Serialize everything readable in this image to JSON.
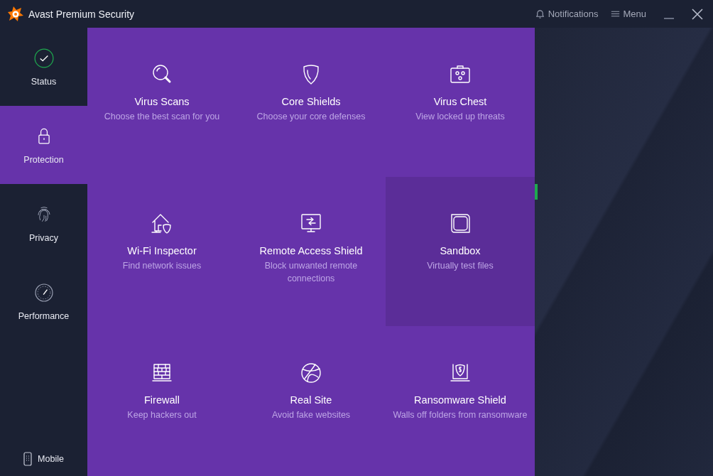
{
  "window": {
    "title": "Avast Premium Security",
    "notifications": "Notifications",
    "menu": "Menu"
  },
  "sidebar": {
    "items": [
      {
        "label": "Status",
        "selected": false
      },
      {
        "label": "Protection",
        "selected": true
      },
      {
        "label": "Privacy",
        "selected": false
      },
      {
        "label": "Performance",
        "selected": false
      }
    ],
    "mobile": "Mobile"
  },
  "tiles": [
    {
      "title": "Virus Scans",
      "subtitle": "Choose the best scan for you",
      "highlighted": false
    },
    {
      "title": "Core Shields",
      "subtitle": "Choose your core defenses",
      "highlighted": false
    },
    {
      "title": "Virus Chest",
      "subtitle": "View locked up threats",
      "highlighted": false
    },
    {
      "title": "Wi-Fi Inspector",
      "subtitle": "Find network issues",
      "highlighted": false
    },
    {
      "title": "Remote Access Shield",
      "subtitle": "Block unwanted remote connections",
      "highlighted": false
    },
    {
      "title": "Sandbox",
      "subtitle": "Virtually test files",
      "highlighted": true
    },
    {
      "title": "Firewall",
      "subtitle": "Keep hackers out",
      "highlighted": false
    },
    {
      "title": "Real Site",
      "subtitle": "Avoid fake websites",
      "highlighted": false
    },
    {
      "title": "Ransomware Shield",
      "subtitle": "Walls off folders from ransomware",
      "highlighted": false
    }
  ]
}
